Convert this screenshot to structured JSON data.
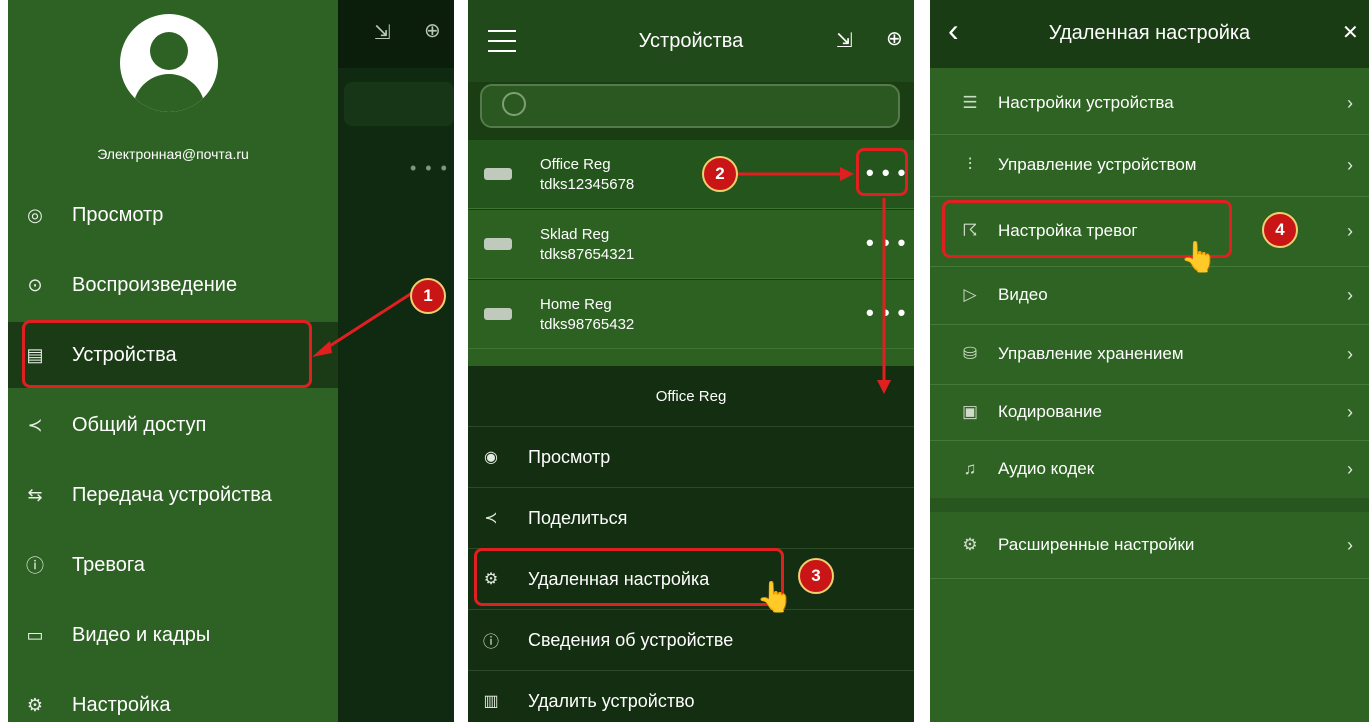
{
  "panel1": {
    "email": "Электронная@почта.ru",
    "menu": [
      {
        "label": "Просмотр",
        "icon": "◎"
      },
      {
        "label": "Воспроизведение",
        "icon": "⊙"
      },
      {
        "label": "Устройства",
        "icon": "▤"
      },
      {
        "label": "Общий доступ",
        "icon": "≺"
      },
      {
        "label": "Передача устройства",
        "icon": "⇆"
      },
      {
        "label": "Тревога",
        "icon": "ⓘ"
      },
      {
        "label": "Видео и кадры",
        "icon": "▭"
      },
      {
        "label": "Настройка",
        "icon": "⚙"
      }
    ],
    "step_badge": "1",
    "more_label": "• • •",
    "header_icons": {
      "import": "⇲",
      "add": "⊕"
    }
  },
  "panel2": {
    "title": "Устройства",
    "header_icons": {
      "import": "⇲",
      "add": "⊕"
    },
    "devices": [
      {
        "name": "Office Reg",
        "id": "tdks12345678",
        "more": "• • •"
      },
      {
        "name": "Sklad Reg",
        "id": "tdks87654321",
        "more": "• • •"
      },
      {
        "name": "Home Reg",
        "id": "tdks98765432",
        "more": "• • •"
      }
    ],
    "sheet_title": "Office Reg",
    "actions": [
      {
        "label": "Просмотр",
        "icon": "◉"
      },
      {
        "label": "Поделиться",
        "icon": "≺"
      },
      {
        "label": "Удаленная настройка",
        "icon": "⚙"
      },
      {
        "label": "Сведения об устройстве",
        "icon": "ⓘ"
      },
      {
        "label": "Удалить устройство",
        "icon": "▥"
      }
    ],
    "step_badges": [
      "2",
      "3"
    ]
  },
  "panel3": {
    "title": "Удаленная настройка",
    "back_icon": "‹",
    "close_icon": "✕",
    "items": [
      {
        "label": "Настройки устройства",
        "icon": "☰"
      },
      {
        "label": "Управление устройством",
        "icon": "⫶"
      },
      {
        "label": "Настройка тревог",
        "icon": "☈"
      },
      {
        "label": "Видео",
        "icon": "▷"
      },
      {
        "label": "Управление хранением",
        "icon": "⛁"
      },
      {
        "label": "Кодирование",
        "icon": "▣"
      },
      {
        "label": "Аудио кодек",
        "icon": "♫"
      },
      {
        "label": "Расширенные настройки",
        "icon": "⚙"
      }
    ],
    "chevron": "›",
    "step_badge": "4"
  },
  "colors": {
    "accent": "#e02020",
    "drawer": "#2e6224",
    "sheet": "#132e10"
  }
}
